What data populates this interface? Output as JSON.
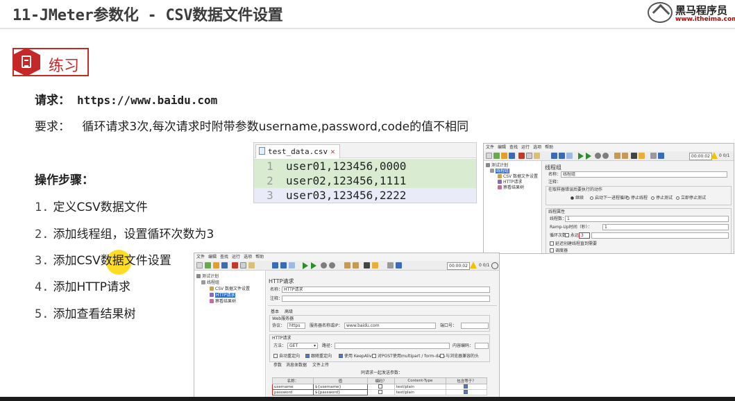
{
  "slide": {
    "title": "11-JMeter参数化 - CSV数据文件设置",
    "brand_name": "黑马程序员",
    "brand_url": "www.itheima.com",
    "badge_label": "练习",
    "request_label": "请求：",
    "request_url": "https://www.baidu.com",
    "requirement_label": "要求：",
    "requirement_text": "循环请求3次,每次请求时附带参数username,password,code的值不相同",
    "steps_title": "操作步骤：",
    "steps": [
      {
        "num": "1.",
        "text": "定义CSV数据文件"
      },
      {
        "num": "2.",
        "text": "添加线程组，设置循环次数为3"
      },
      {
        "num": "3.",
        "text": "添加CSV数据文件设置"
      },
      {
        "num": "4.",
        "text": "添加HTTP请求"
      },
      {
        "num": "5.",
        "text": "添加查看结果树"
      }
    ]
  },
  "csv_editor": {
    "tab_name": "test_data.csv",
    "lines": [
      {
        "num": "1",
        "text": "user01,123456,0000"
      },
      {
        "num": "2",
        "text": "user02,123456,1111"
      },
      {
        "num": "3",
        "text": "user03,123456,2222"
      }
    ]
  },
  "jmeter_top": {
    "menu": [
      "文件",
      "编辑",
      "查找",
      "运行",
      "选项",
      "帮助"
    ],
    "timer": "00:00:02",
    "count": "0 0/1",
    "tree": [
      "测试计划",
      "线程组",
      "CSV 数据文件设置",
      "HTTP请求",
      "察看结果树"
    ],
    "panel_title": "线程组",
    "name_label": "名称：",
    "name_value": "线程组",
    "comment_label": "注释：",
    "error_action_label": "在取样器错误后要执行的动作",
    "error_actions": [
      "继续",
      "启动下一进程循环",
      "停止线程",
      "停止测试",
      "立即停止测试"
    ],
    "thread_props_label": "线程属性",
    "threads_label": "线程数：",
    "threads_value": "1",
    "rampup_label": "Ramp-Up时间（秒）：",
    "rampup_value": "1",
    "loop_label": "循环次数",
    "forever_label": "永远",
    "loop_value": "3",
    "delay_label": "延迟创建线程直到需要",
    "scheduler_label": "调度器"
  },
  "jmeter_bottom": {
    "menu": [
      "文件",
      "编辑",
      "查找",
      "运行",
      "选项",
      "帮助"
    ],
    "timer": "00:00:02",
    "count": "0 0/1",
    "tree": [
      "测试计划",
      "线程组",
      "CSV 数据文件设置",
      "HTTP请求",
      "察看结果树"
    ],
    "panel_title": "HTTP请求",
    "name_label": "名称：",
    "name_value": "HTTP请求",
    "comment_label": "注释：",
    "tabs": [
      "基本",
      "高级"
    ],
    "web_server_label": "Web服务器",
    "protocol_label": "协议：",
    "protocol_value": "https",
    "server_label": "服务器名称或IP：",
    "server_value": "www.baidu.com",
    "port_label": "端口号：",
    "http_request_label": "HTTP请求",
    "method_label": "方法：",
    "method_value": "GET",
    "path_label": "路径：",
    "encoding_label": "内容编码：",
    "options": [
      "自动重定向",
      "跟随重定向",
      "使用 KeepAlive",
      "对POST使用multipart / form-data",
      "与浏览器兼容的头"
    ],
    "subtabs": [
      "参数",
      "消息体数据",
      "文件上传"
    ],
    "params_caption": "同请求一起发送参数：",
    "columns": [
      "名称：",
      "值",
      "编码？",
      "Content-Type",
      "包含等于？"
    ],
    "rows": [
      {
        "name": "username",
        "value": "${username}",
        "ctype": "text/plain"
      },
      {
        "name": "password",
        "value": "${password}",
        "ctype": "text/plain"
      }
    ]
  }
}
